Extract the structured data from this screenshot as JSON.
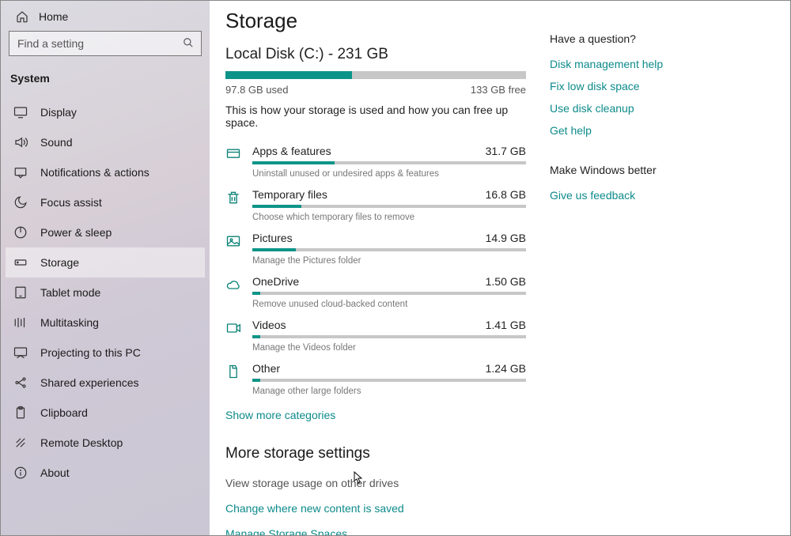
{
  "sidebar": {
    "home_label": "Home",
    "search_placeholder": "Find a setting",
    "category_header": "System",
    "items": [
      {
        "label": "Display",
        "icon": "display-icon",
        "selected": false
      },
      {
        "label": "Sound",
        "icon": "sound-icon",
        "selected": false
      },
      {
        "label": "Notifications & actions",
        "icon": "notifications-icon",
        "selected": false
      },
      {
        "label": "Focus assist",
        "icon": "focus-assist-icon",
        "selected": false
      },
      {
        "label": "Power & sleep",
        "icon": "power-icon",
        "selected": false
      },
      {
        "label": "Storage",
        "icon": "storage-icon",
        "selected": true
      },
      {
        "label": "Tablet mode",
        "icon": "tablet-icon",
        "selected": false
      },
      {
        "label": "Multitasking",
        "icon": "multitasking-icon",
        "selected": false
      },
      {
        "label": "Projecting to this PC",
        "icon": "projecting-icon",
        "selected": false
      },
      {
        "label": "Shared experiences",
        "icon": "shared-icon",
        "selected": false
      },
      {
        "label": "Clipboard",
        "icon": "clipboard-icon",
        "selected": false
      },
      {
        "label": "Remote Desktop",
        "icon": "remote-icon",
        "selected": false
      },
      {
        "label": "About",
        "icon": "about-icon",
        "selected": false
      }
    ]
  },
  "page": {
    "title": "Storage",
    "disk_title": "Local Disk (C:) - 231 GB",
    "used_label": "97.8 GB used",
    "free_label": "133 GB free",
    "used_pct": 42,
    "intro": "This is how your storage is used and how you can free up space.",
    "show_more_label": "Show more categories",
    "more_settings_header": "More storage settings",
    "aux_link": "View storage usage on other drives",
    "more_links": [
      "Change where new content is saved",
      "Manage Storage Spaces"
    ]
  },
  "categories": [
    {
      "name": "Apps & features",
      "size": "31.7 GB",
      "pct": 30,
      "desc": "Uninstall unused or undesired apps & features",
      "icon": "apps-icon"
    },
    {
      "name": "Temporary files",
      "size": "16.8 GB",
      "pct": 18,
      "desc": "Choose which temporary files to remove",
      "icon": "trash-icon"
    },
    {
      "name": "Pictures",
      "size": "14.9 GB",
      "pct": 16,
      "desc": "Manage the Pictures folder",
      "icon": "pictures-icon"
    },
    {
      "name": "OneDrive",
      "size": "1.50 GB",
      "pct": 3,
      "desc": "Remove unused cloud-backed content",
      "icon": "cloud-icon"
    },
    {
      "name": "Videos",
      "size": "1.41 GB",
      "pct": 3,
      "desc": "Manage the Videos folder",
      "icon": "videos-icon"
    },
    {
      "name": "Other",
      "size": "1.24 GB",
      "pct": 3,
      "desc": "Manage other large folders",
      "icon": "other-icon"
    }
  ],
  "right_rail": {
    "question_header": "Have a question?",
    "question_links": [
      "Disk management help",
      "Fix low disk space",
      "Use disk cleanup",
      "Get help"
    ],
    "feedback_header": "Make Windows better",
    "feedback_link": "Give us feedback"
  },
  "colors": {
    "accent": "#0d9488",
    "link": "#0d8a8a"
  }
}
